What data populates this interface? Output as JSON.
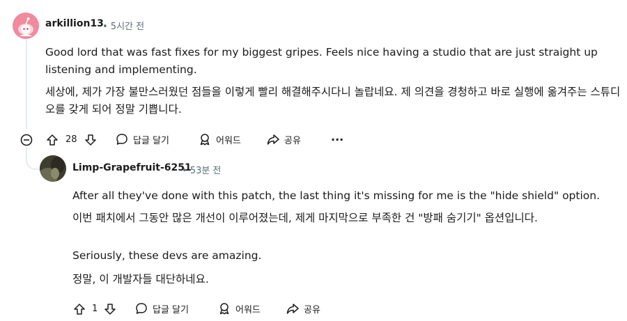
{
  "comment": {
    "username": "arkillion13",
    "meta": "• 5시간 전",
    "body_en": "Good lord that was fast fixes for my biggest gripes. Feels nice having a studio that are just straight up listening and implementing.",
    "body_ko": "세상에, 제가 가장 불만스러웠던 점들을 이렇게 빨리 해결해주시다니 놀랍네요. 제 의견을 경청하고 바로 실행에 옮겨주는 스튜디오를 갖게 되어 정말 기쁩니다.",
    "votes": "28",
    "reply_label": "답글 달기",
    "award_label": "어워드",
    "share_label": "공유",
    "more_label": "···"
  },
  "reply": {
    "username": "Limp-Grapefruit-6251",
    "meta": "• 53분 전",
    "paragraphs": [
      "After all they've done with this patch, the last thing it's missing for me is the \"hide shield\" option.",
      "이번 패치에서 그동안 많은 개선이 이루어졌는데, 제게 마지막으로 부족한 건 \"방패 숨기기\" 옵션입니다.",
      "Seriously, these devs are amazing.",
      "정말, 이 개발자들 대단하네요."
    ],
    "votes": "1",
    "reply_label": "답글 달기",
    "award_label": "어워드",
    "share_label": "공유"
  },
  "icons": {
    "avatar_main": "snoo-avatar",
    "avatar_reply": "user-photo-avatar",
    "upvote": "upvote-arrow-icon",
    "downvote": "downvote-arrow-icon",
    "reply": "speech-bubble-icon",
    "award": "award-ribbon-icon",
    "share": "share-arrow-icon",
    "collapse": "collapse-minus-icon"
  },
  "colors": {
    "avatar_main_bg": "#f08a9e",
    "text": "#1a1a1b",
    "muted": "#576f76",
    "thread": "#e5ebee"
  }
}
